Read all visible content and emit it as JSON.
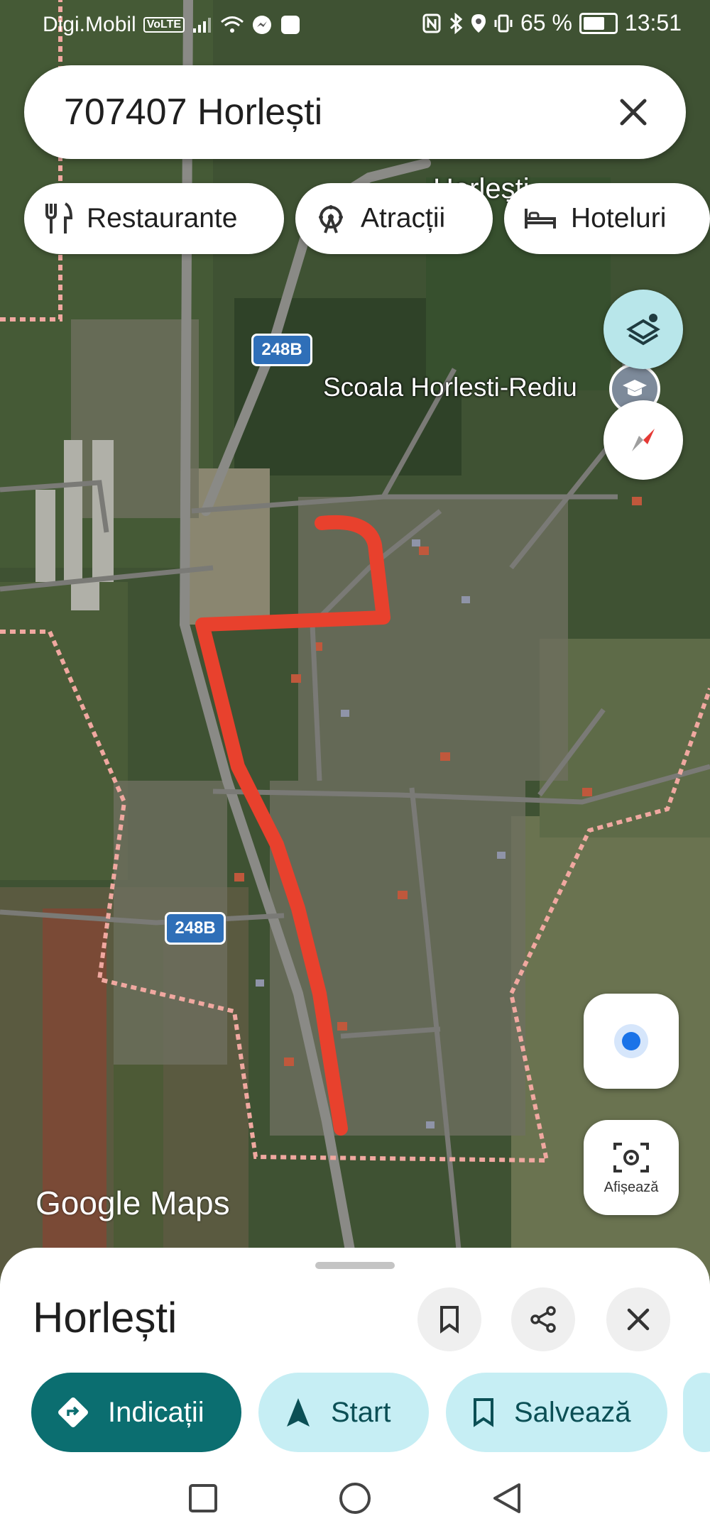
{
  "status_bar": {
    "carrier": "Digi.Mobil",
    "volte": "VoLTE",
    "battery_pct": "65 %",
    "time": "13:51"
  },
  "search": {
    "value": "707407 Horlești"
  },
  "chips": [
    {
      "label": "Restaurante",
      "icon": "fork-knife-icon"
    },
    {
      "label": "Atracții",
      "icon": "ferris-wheel-icon"
    },
    {
      "label": "Hoteluri",
      "icon": "bed-icon"
    }
  ],
  "map": {
    "labels": {
      "school": "Scoala Horlesti-Rediu",
      "town_partial": "Horlești",
      "road_1": "248B",
      "road_2": "248B",
      "watermark": "Google Maps"
    },
    "route_color": "#e8412d"
  },
  "controls": {
    "layers_icon": "layers-icon",
    "compass_icon": "compass-icon",
    "location_icon": "my-location-icon",
    "lens_label": "Afișează"
  },
  "sheet": {
    "title": "Horlești",
    "actions": [
      {
        "label": "Indicații",
        "icon": "directions-icon"
      },
      {
        "label": "Start",
        "icon": "navigation-arrow-icon"
      },
      {
        "label": "Salvează",
        "icon": "bookmark-icon"
      }
    ]
  },
  "colors": {
    "primary_button": "#0b6e70",
    "secondary_button": "#c6eef4",
    "secondary_text": "#0b4f55",
    "layers_button": "#b8e6ea",
    "location_dot": "#1a73e8"
  }
}
